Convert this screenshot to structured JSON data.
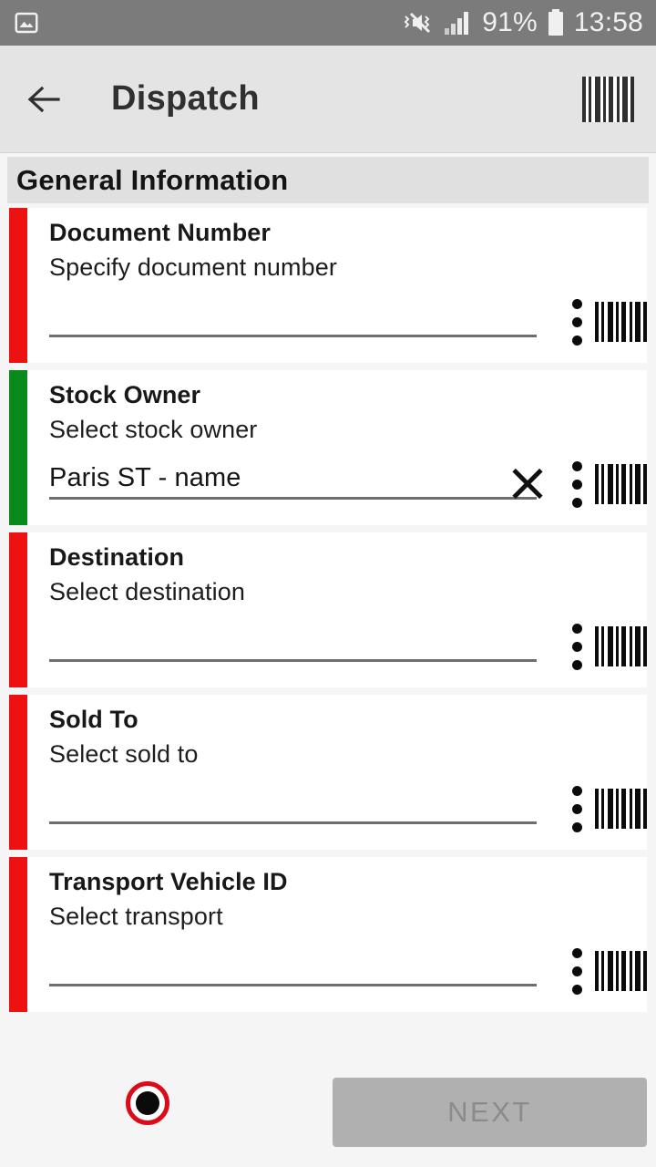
{
  "status_bar": {
    "left_icons": [
      "image-icon"
    ],
    "mute_icon": "vibrate-mute-icon",
    "signal_icon": "signal-bars-icon",
    "battery_text": "91%",
    "battery_icon": "battery-icon",
    "time": "13:58"
  },
  "app_bar": {
    "back_icon": "back-arrow-icon",
    "title": "Dispatch",
    "barcode_icon": "barcode-icon"
  },
  "section": {
    "title": "General Information"
  },
  "colors": {
    "required_accent": "#ee1111",
    "valid_accent": "#0a8a1a",
    "record_ring": "#dd0b17",
    "next_disabled_bg": "#b0b0b0",
    "next_disabled_text": "#8b8b8b",
    "status_bar_bg": "#7b7b7b",
    "app_bar_bg": "#e4e4e4",
    "section_header_bg": "#e0e0e0",
    "page_bg": "#f5f5f5",
    "card_bg": "#ffffff"
  },
  "fields": [
    {
      "label": "Document Number",
      "hint": "Specify document number",
      "value": "",
      "accent": "#ee1111",
      "has_clear": false,
      "kebab_icon": "overflow-menu-icon",
      "barcode_icon": "barcode-scan-icon"
    },
    {
      "label": "Stock Owner",
      "hint": "Select stock owner",
      "value": "Paris ST - name",
      "accent": "#0a8a1a",
      "has_clear": true,
      "clear_icon": "clear-x-icon",
      "kebab_icon": "overflow-menu-icon",
      "barcode_icon": "barcode-scan-icon"
    },
    {
      "label": "Destination",
      "hint": "Select destination",
      "value": "",
      "accent": "#ee1111",
      "has_clear": false,
      "kebab_icon": "overflow-menu-icon",
      "barcode_icon": "barcode-scan-icon"
    },
    {
      "label": "Sold To",
      "hint": "Select sold to",
      "value": "",
      "accent": "#ee1111",
      "has_clear": false,
      "kebab_icon": "overflow-menu-icon",
      "barcode_icon": "barcode-scan-icon"
    },
    {
      "label": "Transport Vehicle ID",
      "hint": "Select transport",
      "value": "",
      "accent": "#ee1111",
      "has_clear": false,
      "kebab_icon": "overflow-menu-icon",
      "barcode_icon": "barcode-scan-icon"
    }
  ],
  "bottom_bar": {
    "record_icon": "record-button-icon",
    "next_label": "NEXT",
    "next_enabled": false
  }
}
